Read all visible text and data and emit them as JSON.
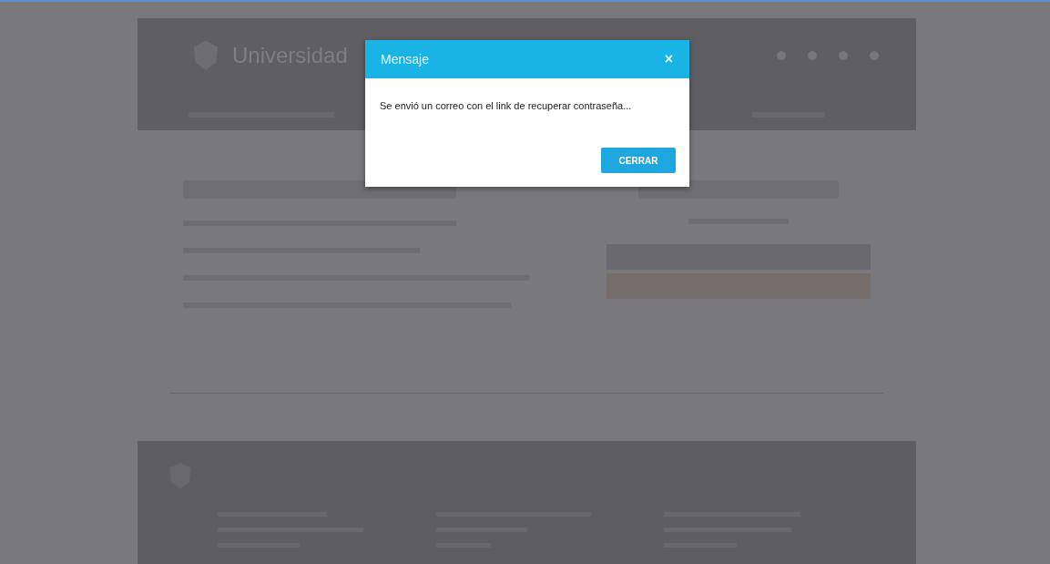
{
  "header": {
    "brand": "Universidad"
  },
  "dialog": {
    "title": "Mensaje",
    "close": "×",
    "message": "Se envió un correo con el link de recuperar contraseña...",
    "button": "CERRAR"
  }
}
